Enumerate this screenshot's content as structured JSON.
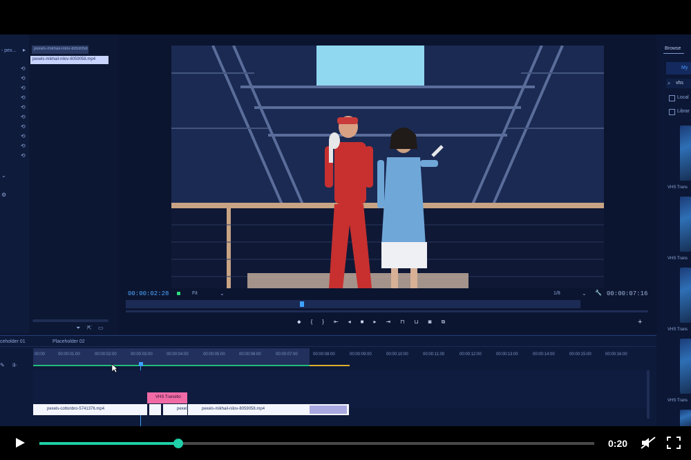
{
  "project": {
    "file_search": "pexels-mikhail-nilov-8059058.mp4",
    "file_tooltip": "pexels-mikhail-nilov-8059058.mp4",
    "bin_label": "- pex..."
  },
  "monitor": {
    "timecode_current": "00:00:02:28",
    "fit_label": "Fit",
    "quality_label": "1/8",
    "timecode_duration": "00:00:07:16"
  },
  "timeline": {
    "tab_left": "ceholder 01",
    "tab_right": "Placeholder 02",
    "ruler_labels": [
      "00:00",
      "00:00:01:00",
      "00:00:02:00",
      "00:00:03:00",
      "00:00:04:00",
      "00:00:05:00",
      "00:00:06:00",
      "00:00:07:00",
      "00:00:08:00",
      "00:00:09:00",
      "00:00:10:00",
      "00:00:11:00",
      "00:00:12:00",
      "00:00:13:00",
      "00:00:14:00",
      "00:00:15:00",
      "00:00:16:00"
    ],
    "clip_1": "pexels-cottonbro-5741376.mp4",
    "clip_2": "pexel",
    "clip_3": "pexels-mikhail-nilov-8059058.mp4",
    "transition_label": "VHS Transitio"
  },
  "browse": {
    "tab_label": "Browse",
    "tab_my": "My",
    "search_value": "vhs",
    "filter_local": "Local",
    "filter_libraries": "Librar",
    "item_labels": [
      "VHS Trans",
      "VHS Trans",
      "VHS Trans",
      "VHS Trans"
    ]
  },
  "player": {
    "time": "0:20",
    "progress": 0.25
  },
  "colors": {
    "accent": "#1fd0a8",
    "timecode": "#4fa6ff",
    "transition": "#f06aa6",
    "clip": "#f4f6ff"
  }
}
